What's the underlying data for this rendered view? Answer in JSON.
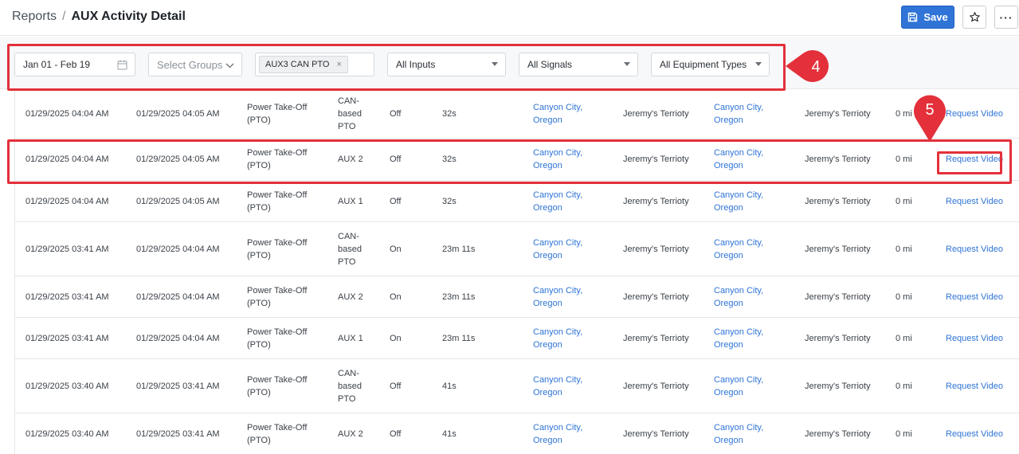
{
  "header": {
    "breadcrumb_root": "Reports",
    "breadcrumb_sep": "/",
    "title": "AUX Activity Detail",
    "save_label": "Save",
    "star_icon": "star-icon",
    "more_label": "···"
  },
  "filters": {
    "date_range": "Jan 01 - Feb 19",
    "groups_placeholder": "Select Groups",
    "selected_tag": "AUX3 CAN PTO",
    "tag_remove": "×",
    "inputs": "All Inputs",
    "signals": "All Signals",
    "equipment_types": "All Equipment Types"
  },
  "annotations": {
    "callout_4": "4",
    "callout_5": "5",
    "color": "#e3303a"
  },
  "table": {
    "rows": [
      {
        "start": "01/29/2025 04:04 AM",
        "end": "01/29/2025 04:05 AM",
        "type_l1": "Power Take-Off",
        "type_l2": "(PTO)",
        "input_lines": [
          "CAN-",
          "based",
          "PTO"
        ],
        "state": "Off",
        "duration": "32s",
        "loc1_l1": "Canyon City,",
        "loc1_l2": "Oregon",
        "driver1": "Jeremy's Terrioty",
        "loc2_l1": "Canyon City,",
        "loc2_l2": "Oregon",
        "driver2": "Jeremy's Terrioty",
        "distance": "0 mi",
        "action": "Request Video"
      },
      {
        "start": "01/29/2025 04:04 AM",
        "end": "01/29/2025 04:05 AM",
        "type_l1": "Power Take-Off",
        "type_l2": "(PTO)",
        "input_lines": [
          "AUX 2"
        ],
        "state": "Off",
        "duration": "32s",
        "loc1_l1": "Canyon City,",
        "loc1_l2": "Oregon",
        "driver1": "Jeremy's Terrioty",
        "loc2_l1": "Canyon City,",
        "loc2_l2": "Oregon",
        "driver2": "Jeremy's Terrioty",
        "distance": "0 mi",
        "action": "Request Video"
      },
      {
        "start": "01/29/2025 04:04 AM",
        "end": "01/29/2025 04:05 AM",
        "type_l1": "Power Take-Off",
        "type_l2": "(PTO)",
        "input_lines": [
          "AUX 1"
        ],
        "state": "Off",
        "duration": "32s",
        "loc1_l1": "Canyon City,",
        "loc1_l2": "Oregon",
        "driver1": "Jeremy's Terrioty",
        "loc2_l1": "Canyon City,",
        "loc2_l2": "Oregon",
        "driver2": "Jeremy's Terrioty",
        "distance": "0 mi",
        "action": "Request Video"
      },
      {
        "start": "01/29/2025 03:41 AM",
        "end": "01/29/2025 04:04 AM",
        "type_l1": "Power Take-Off",
        "type_l2": "(PTO)",
        "input_lines": [
          "CAN-",
          "based",
          "PTO"
        ],
        "state": "On",
        "duration": "23m 11s",
        "loc1_l1": "Canyon City,",
        "loc1_l2": "Oregon",
        "driver1": "Jeremy's Terrioty",
        "loc2_l1": "Canyon City,",
        "loc2_l2": "Oregon",
        "driver2": "Jeremy's Terrioty",
        "distance": "0 mi",
        "action": "Request Video"
      },
      {
        "start": "01/29/2025 03:41 AM",
        "end": "01/29/2025 04:04 AM",
        "type_l1": "Power Take-Off",
        "type_l2": "(PTO)",
        "input_lines": [
          "AUX 2"
        ],
        "state": "On",
        "duration": "23m 11s",
        "loc1_l1": "Canyon City,",
        "loc1_l2": "Oregon",
        "driver1": "Jeremy's Terrioty",
        "loc2_l1": "Canyon City,",
        "loc2_l2": "Oregon",
        "driver2": "Jeremy's Terrioty",
        "distance": "0 mi",
        "action": "Request Video"
      },
      {
        "start": "01/29/2025 03:41 AM",
        "end": "01/29/2025 04:04 AM",
        "type_l1": "Power Take-Off",
        "type_l2": "(PTO)",
        "input_lines": [
          "AUX 1"
        ],
        "state": "On",
        "duration": "23m 11s",
        "loc1_l1": "Canyon City,",
        "loc1_l2": "Oregon",
        "driver1": "Jeremy's Terrioty",
        "loc2_l1": "Canyon City,",
        "loc2_l2": "Oregon",
        "driver2": "Jeremy's Terrioty",
        "distance": "0 mi",
        "action": "Request Video"
      },
      {
        "start": "01/29/2025 03:40 AM",
        "end": "01/29/2025 03:41 AM",
        "type_l1": "Power Take-Off",
        "type_l2": "(PTO)",
        "input_lines": [
          "CAN-",
          "based",
          "PTO"
        ],
        "state": "Off",
        "duration": "41s",
        "loc1_l1": "Canyon City,",
        "loc1_l2": "Oregon",
        "driver1": "Jeremy's Terrioty",
        "loc2_l1": "Canyon City,",
        "loc2_l2": "Oregon",
        "driver2": "Jeremy's Terrioty",
        "distance": "0 mi",
        "action": "Request Video"
      },
      {
        "start": "01/29/2025 03:40 AM",
        "end": "01/29/2025 03:41 AM",
        "type_l1": "Power Take-Off",
        "type_l2": "(PTO)",
        "input_lines": [
          "AUX 2"
        ],
        "state": "Off",
        "duration": "41s",
        "loc1_l1": "Canyon City,",
        "loc1_l2": "Oregon",
        "driver1": "Jeremy's Terrioty",
        "loc2_l1": "Canyon City,",
        "loc2_l2": "Oregon",
        "driver2": "Jeremy's Terrioty",
        "distance": "0 mi",
        "action": "Request Video"
      }
    ]
  }
}
